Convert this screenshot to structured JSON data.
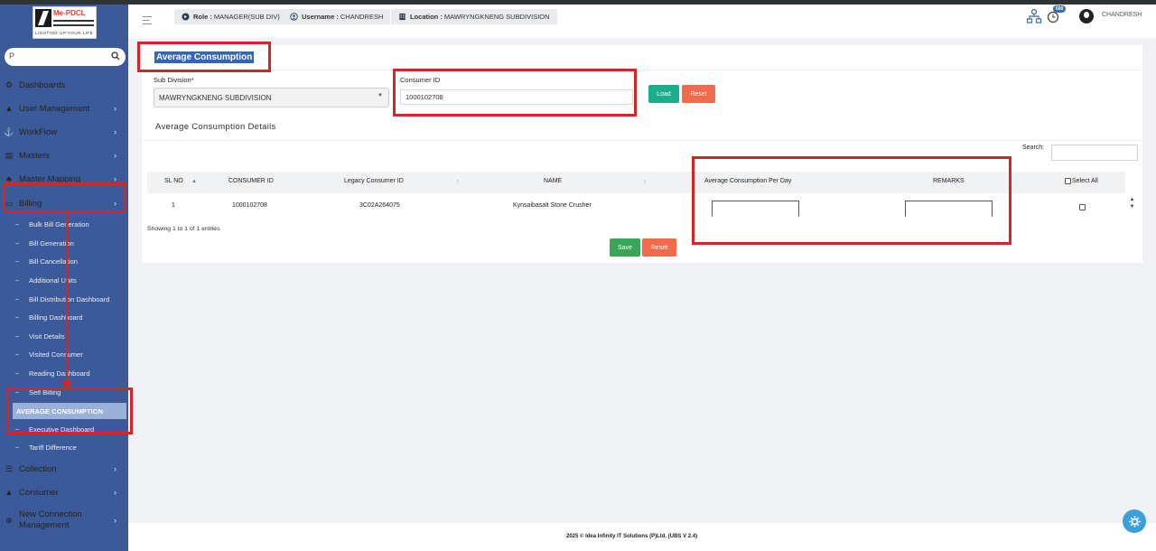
{
  "logo": {
    "name": "Me-PDCL",
    "tagline": "LIGHTING UP YOUR LIFE"
  },
  "sidebar": {
    "search_placeholder": "P",
    "items": [
      {
        "label": "Dashboards",
        "icon": "dashboard-icon",
        "chevron": ""
      },
      {
        "label": "User Management",
        "icon": "user-icon",
        "chevron": "›"
      },
      {
        "label": "WorkFlow",
        "icon": "anchor-icon",
        "chevron": "›"
      },
      {
        "label": "Masters",
        "icon": "table-icon",
        "chevron": "›"
      },
      {
        "label": "Master Mapping",
        "icon": "sitemap-icon",
        "chevron": "›"
      },
      {
        "label": "Billing",
        "icon": "monitor-icon",
        "chevron": "›"
      }
    ],
    "billing_sub": [
      "Bulk Bill Generation",
      "Bill Generation",
      "Bill Cancellation",
      "Additional Units",
      "Bill Distribution Dashboard",
      "Billing Dashboard",
      "Visit Details",
      "Visited Consumer",
      "Reading Dashboard",
      "Self Billing",
      "AVERAGE CONSUMPTION",
      "Executive Dashboard",
      "Tariff Difference"
    ],
    "bottom_items": [
      {
        "label": "Collection",
        "icon": "list-icon",
        "chevron": "›"
      },
      {
        "label": "Consumer",
        "icon": "user-icon",
        "chevron": "›"
      },
      {
        "label": "New Connection Management",
        "icon": "plus-circle-icon",
        "chevron": "›"
      }
    ]
  },
  "header": {
    "role_label": "Role :",
    "role_value": "MANAGER(SUB DIV)",
    "username_label": "Username :",
    "username_value": "CHANDRESH",
    "location_label": "Location :",
    "location_value": "MAWRYNGKNENG SUBDIVISION",
    "notification_count": "600",
    "user_name": "CHANDRESH"
  },
  "page": {
    "title": "Average Consumption",
    "sub_division_label": "Sub Division*",
    "sub_division_value": "MAWRYNGKNENG SUBDIVISION",
    "consumer_id_label": "Consumer ID",
    "consumer_id_value": "1000102708",
    "load_label": "Load",
    "reset_label": "Reset",
    "details_title": "Average Consumption Details",
    "search_label": "Search:",
    "search_value": ""
  },
  "table": {
    "headers": {
      "sl_no": "SL NO",
      "consumer_id": "CONSUMER ID",
      "legacy_consumer_id": "Legacy Consumer ID",
      "name": "NAME",
      "avg_consumption": "Average Consumption Per Day",
      "remarks": "REMARKS",
      "select_all": "Select All"
    },
    "rows": [
      {
        "sl_no": "1",
        "consumer_id": "1000102708",
        "legacy_consumer_id": "3C02A264075",
        "name": "Kynsaibasalt Stone Crusher",
        "avg_consumption": "",
        "remarks": ""
      }
    ],
    "showing": "Showing 1 to 1 of 1 entries"
  },
  "actions": {
    "save_label": "Save",
    "reset_label": "Reset"
  },
  "footer": {
    "text": "2025 © Idea Infinity IT Solutions (P)Ltd. (UBS V 2.4)"
  },
  "colors": {
    "sidebar": "#3c5a99",
    "accent_green": "#1aae8b",
    "accent_orange": "#ef6b4b",
    "annotation_red": "#d32626"
  }
}
